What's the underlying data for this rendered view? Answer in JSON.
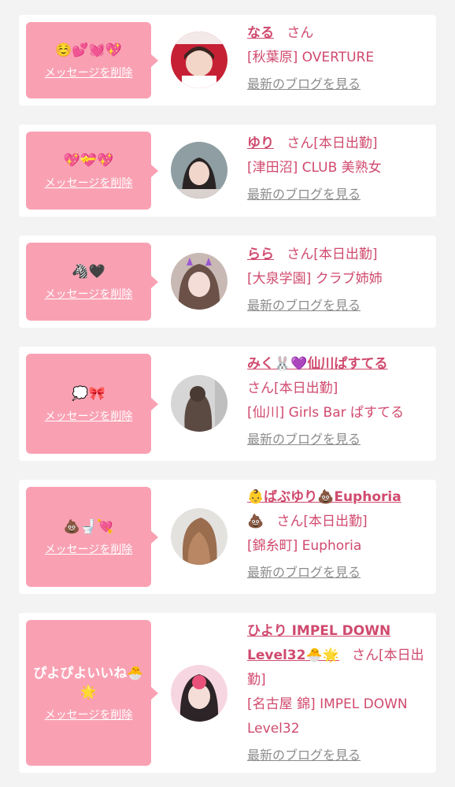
{
  "delete_label": "メッセージを削除",
  "blog_label": "最新のブログを見る",
  "san_suffix": "さん",
  "colors": {
    "bubble": "#f9a1b3",
    "name": "#d04a6e",
    "link_gray": "#8c8c8c",
    "background": "#f3f3f3"
  },
  "cards": [
    {
      "message": "☺️💕💓💖",
      "name": "なる",
      "status": "",
      "shop": "[秋葉原] OVERTURE"
    },
    {
      "message": "💖💝💖",
      "name": "ゆり",
      "status": "[本日出勤]",
      "shop": "[津田沼] CLUB 美熟女"
    },
    {
      "message": "🦓🖤",
      "name": "らら",
      "status": "[本日出勤]",
      "shop": "[大泉学園] クラブ姉姉"
    },
    {
      "message": "💭🎀",
      "name": "みく🐰💜仙川ぱすてる",
      "status": "[本日出勤]",
      "shop": "[仙川] Girls Bar ぱすてる"
    },
    {
      "message": "💩🚽💘",
      "name": "👶ばぶゆり💩Euphoria",
      "name_tail": "💩",
      "status": "[本日出勤]",
      "shop": "[錦糸町] Euphoria"
    },
    {
      "message": "ぴよぴよいいね🐣🌟",
      "name": "ひより IMPEL DOWN Level32🐣🌟",
      "status": "[本日出勤]",
      "shop": "[名古屋 錦] IMPEL DOWN Level32"
    }
  ]
}
